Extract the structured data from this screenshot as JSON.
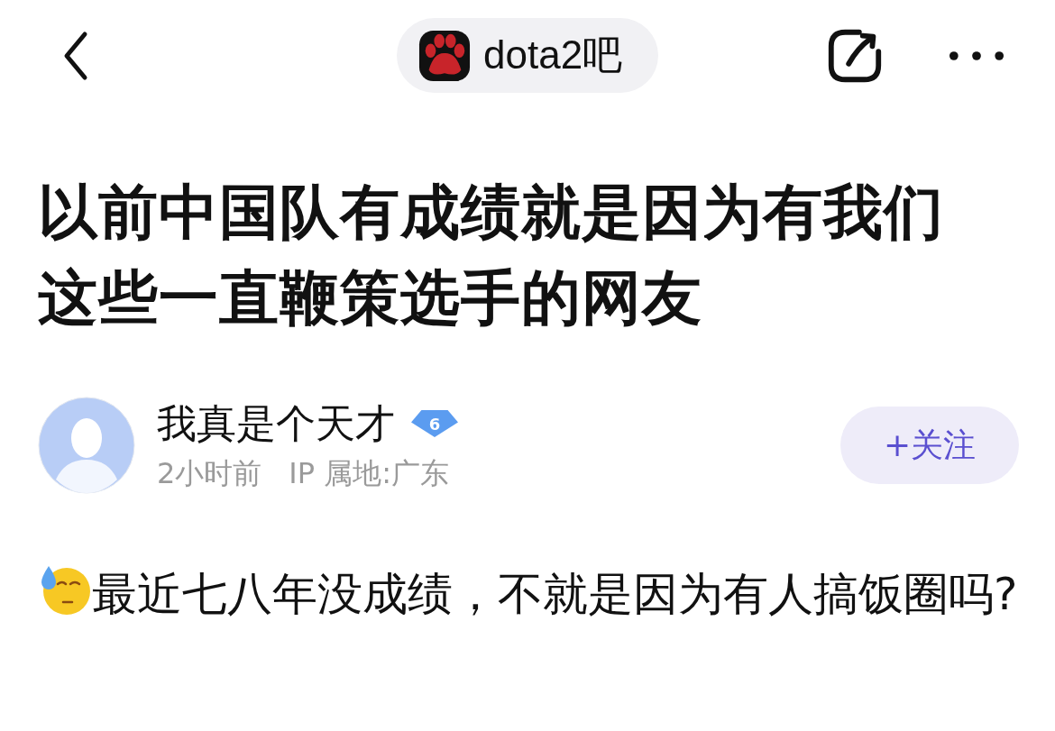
{
  "header": {
    "forum_name": "dota2吧"
  },
  "post": {
    "title": "以前中国队有成绩就是因为有我们这些一直鞭策选手的网友",
    "author": {
      "name": "我真是个天才",
      "level": "6",
      "time": "2小时前",
      "ip_location": "IP 属地:广东",
      "follow_label": "+关注"
    },
    "body": "最近七八年没成绩，不就是因为有人搞饭圈吗?"
  }
}
